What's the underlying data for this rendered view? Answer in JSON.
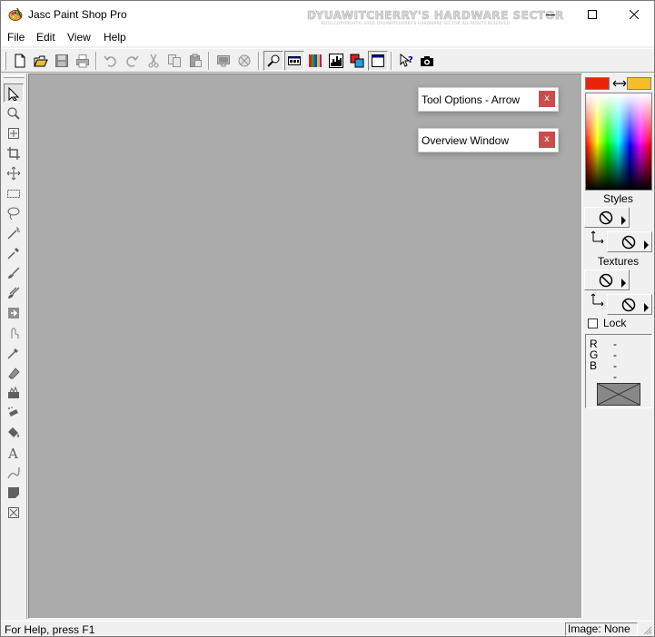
{
  "window": {
    "title": "Jasc Paint Shop Pro",
    "watermark_main": "DYUAWITCHERRY'S HARDWARE SECTOR",
    "watermark_sub": "BLOG.COPYRIGHT© 2018. DYUAWITCHERRY'S HARDWARE SECTOR ALL RIGHTS RESERVED."
  },
  "menu": {
    "items": [
      {
        "label": "File"
      },
      {
        "label": "Edit"
      },
      {
        "label": "View"
      },
      {
        "label": "Help"
      }
    ]
  },
  "toolbar": {
    "buttons": [
      "new-document",
      "open",
      "save",
      "print",
      "undo",
      "redo",
      "cut",
      "copy",
      "paste",
      "full-screen-preview",
      "browse",
      "toggle-overview",
      "toggle-tool-options",
      "toggle-color-palette",
      "toggle-histogram",
      "toggle-layer-palette",
      "toggle-tool-palette",
      "context-help",
      "screen-capture"
    ]
  },
  "tools": [
    "arrow",
    "zoom",
    "deform",
    "crop",
    "mover",
    "selection",
    "freehand",
    "magic-wand",
    "dropper",
    "paint-brush",
    "clone-brush",
    "color-replacer",
    "retouch",
    "scratch-remover",
    "eraser",
    "picture-tube",
    "airbrush",
    "flood-fill",
    "text",
    "draw",
    "preset-shapes",
    "object-selector"
  ],
  "palettes": {
    "tool_options": {
      "title": "Tool Options - Arrow",
      "close": "x"
    },
    "overview": {
      "title": "Overview Window",
      "close": "x"
    }
  },
  "color_palette": {
    "foreground_color": "#e8230a",
    "background_color": "#f5be28",
    "styles_label": "Styles",
    "textures_label": "Textures",
    "lock_label": "Lock",
    "lock_checked": false,
    "r_label": "R",
    "g_label": "G",
    "b_label": "B",
    "r_value": "--",
    "g_value": "--",
    "b_value": "--"
  },
  "status": {
    "help_text": "For Help, press F1",
    "image_text": "Image: None"
  }
}
